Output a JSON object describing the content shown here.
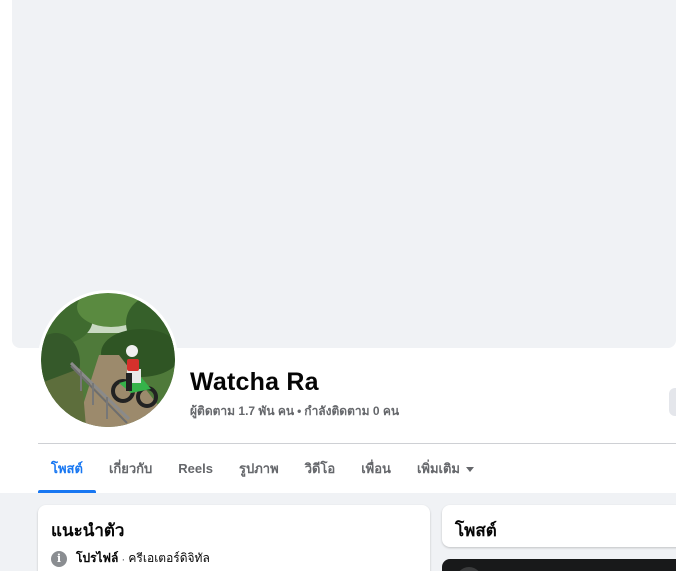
{
  "profile": {
    "name": "Watcha Ra",
    "followers": "ผู้ติดตาม 1.7 พัน คน",
    "separator": "•",
    "following": "กำลังติดตาม 0 คน"
  },
  "tabs": [
    {
      "label": "โพสต์",
      "active": true
    },
    {
      "label": "เกี่ยวกับ",
      "active": false
    },
    {
      "label": "Reels",
      "active": false
    },
    {
      "label": "รูปภาพ",
      "active": false
    },
    {
      "label": "วิดีโอ",
      "active": false
    },
    {
      "label": "เพื่อน",
      "active": false
    },
    {
      "label": "เพิ่มเติม",
      "active": false
    }
  ],
  "intro": {
    "title": "แนะนำตัว",
    "info_icon": "info-icon",
    "profile_label": "โปรไฟล์",
    "dot": "·",
    "category": "ครีเอเตอร์ดิจิทัล"
  },
  "posts": {
    "title": "โพสต์"
  },
  "colors": {
    "accent": "#1877f2",
    "background": "#f0f2f5",
    "secondary_text": "#65676b"
  }
}
